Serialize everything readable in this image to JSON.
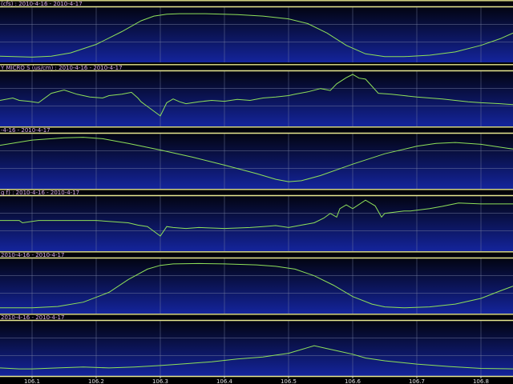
{
  "colors": {
    "background_top": "#000000",
    "background_bottom": "#14249c",
    "separator": "#e8e890",
    "grid": "#7d86a8",
    "series": "#8ee05a",
    "title_text": "#d8a8e8",
    "tick_text": "#e0e0e0"
  },
  "chart_data": {
    "type": "line",
    "xlim": [
      106.05,
      106.85
    ],
    "xticks": [
      106.1,
      106.2,
      106.3,
      106.4,
      106.5,
      106.6,
      106.7,
      106.8
    ],
    "xtick_labels": [
      "106.1",
      "106.2",
      "106.3",
      "106.4",
      "106.5",
      "106.6",
      "106.7",
      "106.8"
    ],
    "grid": true,
    "panels": [
      {
        "title": "(cfs) : 2010-4-16 - 2010-4-17",
        "ylim": [
          0,
          1
        ],
        "x": [
          106.05,
          106.1,
          106.13,
          106.16,
          106.2,
          106.24,
          106.27,
          106.29,
          106.31,
          106.33,
          106.37,
          106.42,
          106.46,
          106.5,
          106.53,
          106.56,
          106.59,
          106.62,
          106.65,
          106.68,
          106.72,
          106.76,
          106.8,
          106.83,
          106.85
        ],
        "y": [
          0.03,
          0.01,
          0.03,
          0.1,
          0.28,
          0.55,
          0.78,
          0.88,
          0.92,
          0.93,
          0.93,
          0.91,
          0.88,
          0.82,
          0.72,
          0.52,
          0.26,
          0.08,
          0.02,
          0.02,
          0.05,
          0.12,
          0.26,
          0.4,
          0.52
        ]
      },
      {
        "title": "Y MICRO S (us/cm) : 2010-4-16 - 2010-4-17",
        "ylim": [
          0,
          1
        ],
        "x": [
          106.05,
          106.07,
          106.08,
          106.095,
          106.11,
          106.13,
          106.15,
          106.17,
          106.19,
          106.21,
          106.22,
          106.24,
          106.255,
          106.265,
          106.27,
          106.28,
          106.29,
          106.3,
          106.31,
          106.32,
          106.33,
          106.34,
          106.36,
          106.38,
          106.4,
          106.42,
          106.44,
          106.46,
          106.48,
          106.5,
          106.51,
          106.53,
          106.55,
          106.565,
          106.575,
          106.59,
          106.6,
          106.61,
          106.62,
          106.64,
          106.66,
          106.68,
          106.7,
          106.72,
          106.74,
          106.76,
          106.78,
          106.8,
          106.83,
          106.85
        ],
        "y": [
          0.45,
          0.5,
          0.45,
          0.43,
          0.4,
          0.6,
          0.67,
          0.58,
          0.52,
          0.5,
          0.55,
          0.58,
          0.62,
          0.5,
          0.42,
          0.32,
          0.22,
          0.12,
          0.4,
          0.48,
          0.42,
          0.38,
          0.42,
          0.45,
          0.43,
          0.47,
          0.45,
          0.5,
          0.52,
          0.55,
          0.58,
          0.63,
          0.7,
          0.66,
          0.8,
          0.93,
          1.0,
          0.92,
          0.9,
          0.6,
          0.58,
          0.55,
          0.52,
          0.5,
          0.48,
          0.45,
          0.42,
          0.4,
          0.38,
          0.36
        ]
      },
      {
        "title": "-4-16 - 2010-4-17",
        "ylim": [
          0,
          1
        ],
        "x": [
          106.05,
          106.1,
          106.15,
          106.18,
          106.21,
          106.25,
          106.3,
          106.35,
          106.4,
          106.45,
          106.48,
          106.5,
          106.52,
          106.55,
          106.6,
          106.65,
          106.7,
          106.73,
          106.76,
          106.8,
          106.85
        ],
        "y": [
          0.82,
          0.93,
          0.98,
          0.99,
          0.96,
          0.86,
          0.72,
          0.57,
          0.4,
          0.22,
          0.1,
          0.05,
          0.07,
          0.18,
          0.42,
          0.64,
          0.8,
          0.86,
          0.88,
          0.84,
          0.74
        ]
      },
      {
        "title": "g f) : 2010-4-16 - 2010-4-17",
        "ylim": [
          0,
          1
        ],
        "x": [
          106.05,
          106.08,
          106.085,
          106.11,
          106.15,
          106.2,
          106.25,
          106.265,
          106.28,
          106.29,
          106.3,
          106.31,
          106.32,
          106.34,
          106.36,
          106.4,
          106.44,
          106.46,
          106.48,
          106.5,
          106.52,
          106.54,
          106.555,
          106.565,
          106.575,
          106.58,
          106.59,
          106.6,
          106.62,
          106.635,
          106.645,
          106.65,
          106.68,
          106.69,
          106.72,
          106.74,
          106.765,
          106.8,
          106.85
        ],
        "y": [
          0.55,
          0.55,
          0.5,
          0.55,
          0.55,
          0.55,
          0.5,
          0.45,
          0.42,
          0.32,
          0.22,
          0.42,
          0.4,
          0.38,
          0.4,
          0.38,
          0.4,
          0.42,
          0.44,
          0.4,
          0.45,
          0.5,
          0.6,
          0.7,
          0.62,
          0.8,
          0.88,
          0.8,
          0.98,
          0.86,
          0.62,
          0.7,
          0.75,
          0.75,
          0.8,
          0.85,
          0.92,
          0.9,
          0.9
        ]
      },
      {
        "title": "2010-4-16 - 2010-4-17",
        "ylim": [
          0,
          1
        ],
        "x": [
          106.05,
          106.1,
          106.14,
          106.18,
          106.22,
          106.25,
          106.28,
          106.3,
          106.32,
          106.36,
          106.4,
          106.45,
          106.48,
          106.51,
          106.54,
          106.57,
          106.6,
          106.63,
          106.65,
          106.68,
          106.72,
          106.76,
          106.8,
          106.83,
          106.85
        ],
        "y": [
          0.02,
          0.02,
          0.05,
          0.14,
          0.35,
          0.62,
          0.84,
          0.92,
          0.95,
          0.96,
          0.95,
          0.93,
          0.9,
          0.84,
          0.7,
          0.5,
          0.26,
          0.1,
          0.04,
          0.02,
          0.04,
          0.1,
          0.22,
          0.38,
          0.48
        ]
      },
      {
        "title": "2010-4-16 - 2010-4-17",
        "ylim": [
          0,
          1
        ],
        "x": [
          106.05,
          106.08,
          106.1,
          106.14,
          106.18,
          106.22,
          106.26,
          106.3,
          106.34,
          106.38,
          106.42,
          106.46,
          106.48,
          106.5,
          106.52,
          106.54,
          106.56,
          106.58,
          106.6,
          106.62,
          106.65,
          106.7,
          106.75,
          106.8,
          106.85
        ],
        "y": [
          0.07,
          0.05,
          0.05,
          0.07,
          0.09,
          0.07,
          0.09,
          0.12,
          0.16,
          0.2,
          0.26,
          0.3,
          0.34,
          0.38,
          0.46,
          0.54,
          0.48,
          0.42,
          0.36,
          0.28,
          0.22,
          0.15,
          0.1,
          0.06,
          0.05
        ]
      }
    ]
  }
}
